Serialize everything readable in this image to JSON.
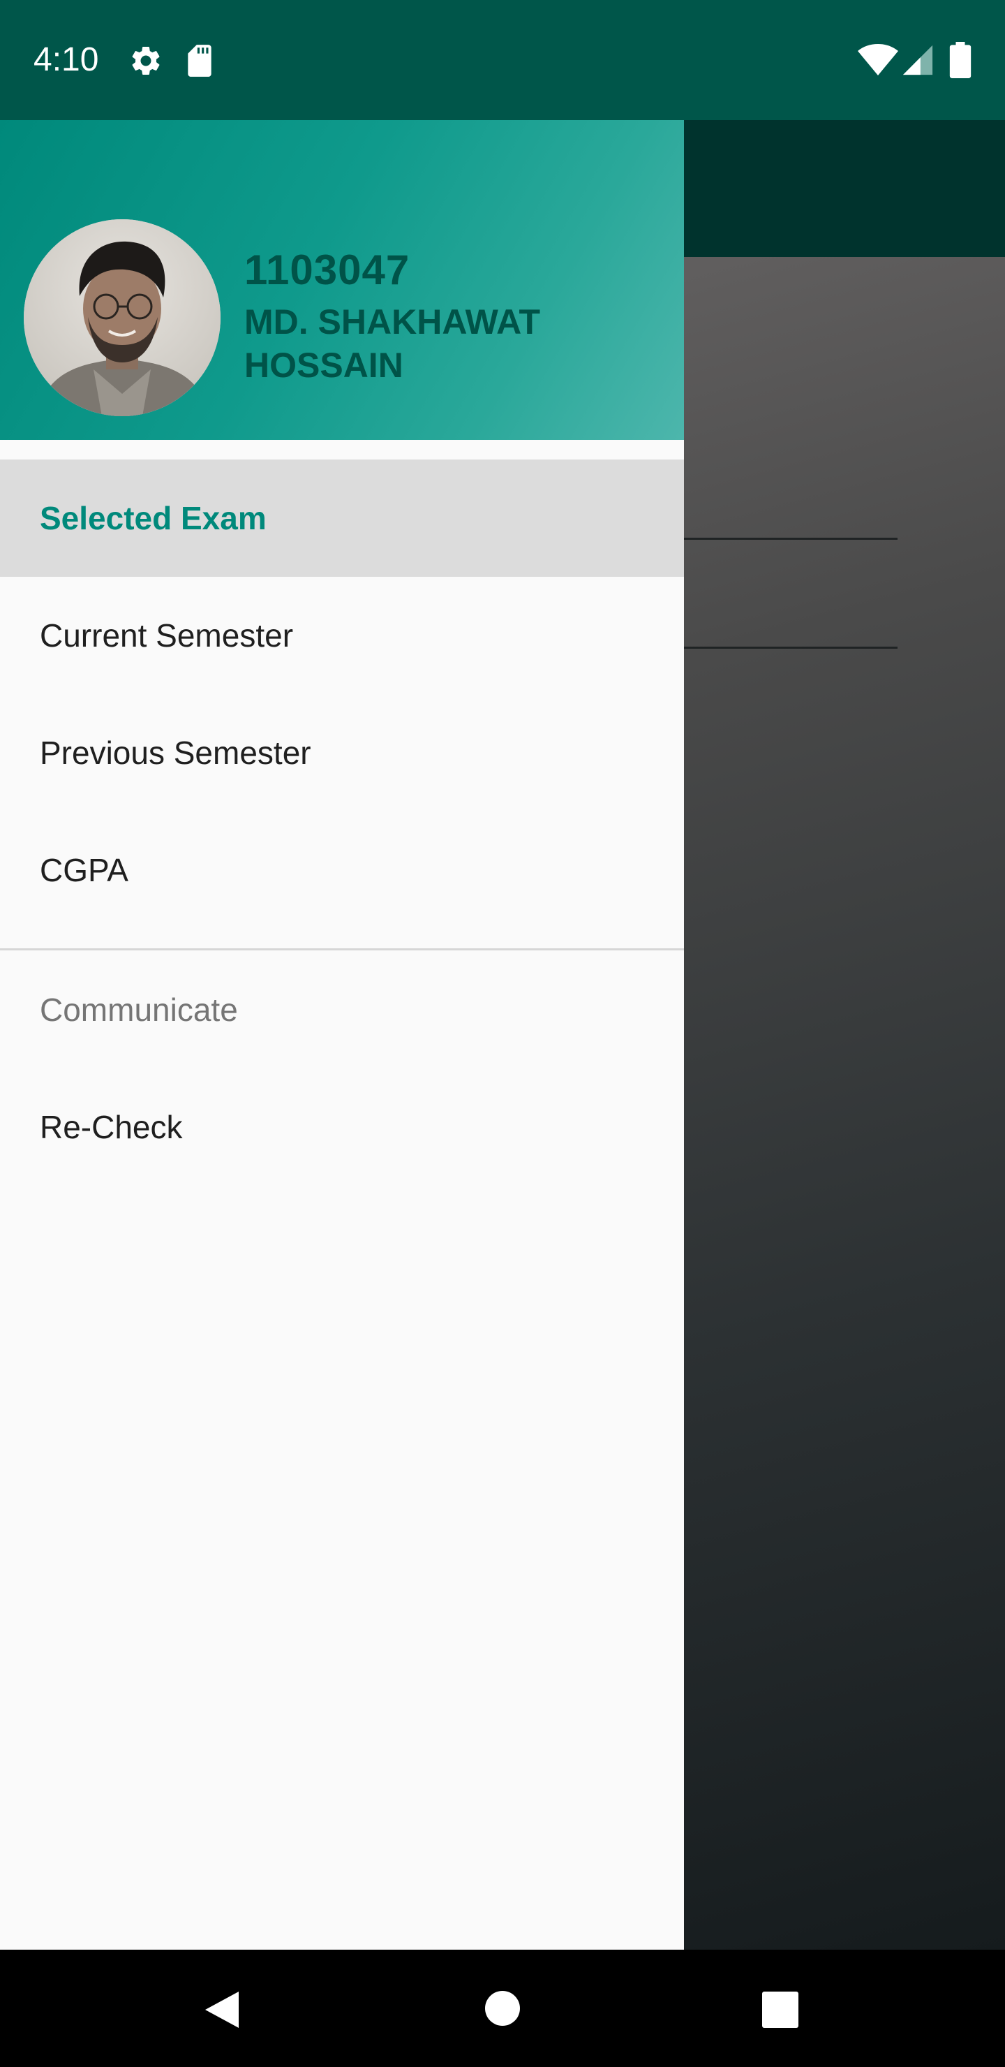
{
  "status_bar": {
    "time": "4:10",
    "icons": [
      "gear-icon",
      "sd-card-icon",
      "wifi-icon",
      "cell-signal-icon",
      "battery-icon"
    ]
  },
  "drawer": {
    "header": {
      "student_id": "1103047",
      "student_name": "MD. SHAKHAWAT HOSSAIN",
      "avatar": "profile-photo"
    },
    "items": [
      {
        "label": "Selected Exam",
        "selected": true
      },
      {
        "label": "Current Semester",
        "selected": false
      },
      {
        "label": "Previous Semester",
        "selected": false
      },
      {
        "label": "CGPA",
        "selected": false
      }
    ],
    "section_title": "Communicate",
    "section_items": [
      {
        "label": "Re-Check"
      }
    ]
  },
  "nav_bar": {
    "buttons": [
      "back-icon",
      "home-icon",
      "recents-icon"
    ]
  },
  "colors": {
    "status_bar": "#00564a",
    "accent": "#00897b",
    "header_text": "#005348",
    "selected_bg": "#dcdcdc",
    "drawer_bg": "#fafafa"
  }
}
